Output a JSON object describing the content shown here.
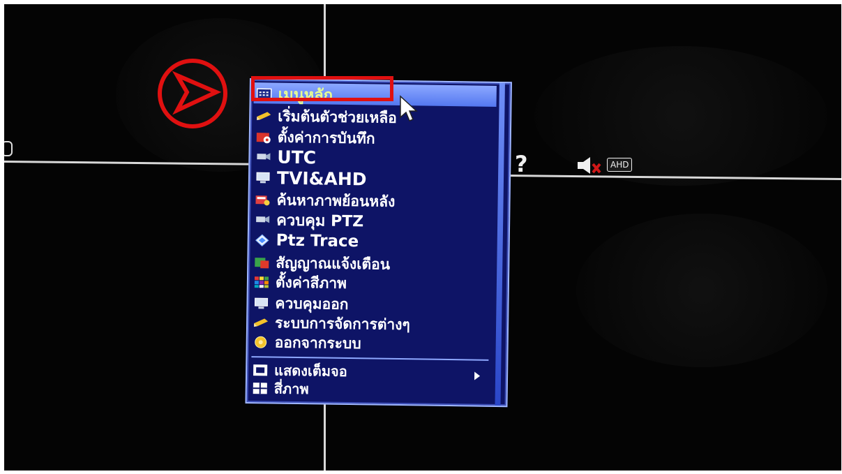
{
  "menu": {
    "header": "เมนูหลัก",
    "items": [
      {
        "label": "เริ่มต้นตัวช่วยเหลือ",
        "icon": "pencil-icon"
      },
      {
        "label": "ตั้งค่าการบันทึก",
        "icon": "record-settings-icon"
      },
      {
        "label": "UTC",
        "icon": "camera-icon"
      },
      {
        "label": "TVI&AHD",
        "icon": "monitor-icon"
      },
      {
        "label": "ค้นหาภาพย้อนหลัง",
        "icon": "playback-search-icon"
      },
      {
        "label": "ควบคุม PTZ",
        "icon": "ptz-camera-icon"
      },
      {
        "label": "Ptz Trace",
        "icon": "diamond-icon"
      },
      {
        "label": "สัญญาณแจ้งเตือน",
        "icon": "alarm-icon"
      },
      {
        "label": "ตั้งค่าสีภาพ",
        "icon": "color-grid-icon"
      },
      {
        "label": "ควบคุมออก",
        "icon": "output-monitor-icon"
      },
      {
        "label": "ระบบการจัดการต่างๆ",
        "icon": "pencil-icon"
      },
      {
        "label": "ออกจากระบบ",
        "icon": "logout-icon"
      }
    ],
    "footer_items": [
      {
        "label": "แสดงเต็มจอ",
        "icon": "fullscreen-icon"
      },
      {
        "label": "สี่ภาพ",
        "icon": "quad-view-icon"
      }
    ]
  },
  "osd": {
    "help_glyph": "?",
    "ahd_badge": "AHD"
  },
  "colors": {
    "menu_bg": "#0e1466",
    "menu_header": "#6f8ff7",
    "header_text": "#e8ff90",
    "annotation_red": "#e01010"
  }
}
